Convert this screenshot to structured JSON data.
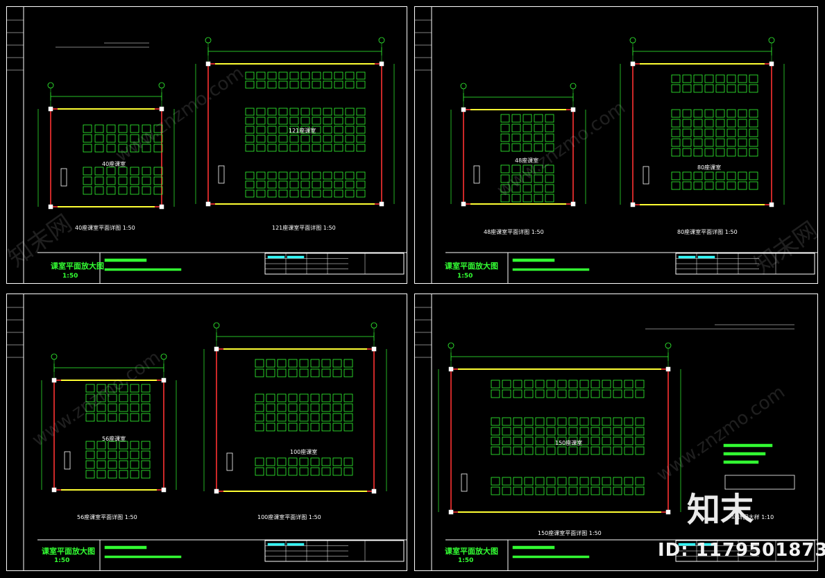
{
  "watermark": {
    "site": "www.znzmo.com",
    "brand_cn": "知末网",
    "logo_text": "知末",
    "id_label": "ID: 1179501873"
  },
  "sheets": [
    {
      "title": "课室平面放大图",
      "scale": "1:50",
      "plans": [
        {
          "name": "40座课室平面详图  1:50",
          "room_label": "40座课室"
        },
        {
          "name": "121座课室平面详图  1:50",
          "room_label": "121座课室"
        }
      ]
    },
    {
      "title": "课室平面放大图",
      "scale": "1:50",
      "plans": [
        {
          "name": "48座课室平面详图  1:50",
          "room_label": "48座课室"
        },
        {
          "name": "80座课室平面详图  1:50",
          "room_label": "80座课室"
        }
      ]
    },
    {
      "title": "课室平面放大图",
      "scale": "1:50",
      "plans": [
        {
          "name": "56座课室平面详图  1:50",
          "room_label": "56座课室"
        },
        {
          "name": "100座课室平面详图  1:50",
          "room_label": "100座课室"
        }
      ]
    },
    {
      "title": "课室平面放大图",
      "scale": "1:50",
      "plans": [
        {
          "name": "150座课室平面详图  1:50",
          "room_label": "150座课室"
        },
        {
          "name": "① 详图大样  1:10",
          "room_label": ""
        }
      ]
    }
  ],
  "colors": {
    "wall": "#ff3333",
    "dim": "#33ff33",
    "seat": "#33ff33",
    "window": "#ffff33",
    "frame": "#ffffff",
    "door": "#ffff00"
  }
}
